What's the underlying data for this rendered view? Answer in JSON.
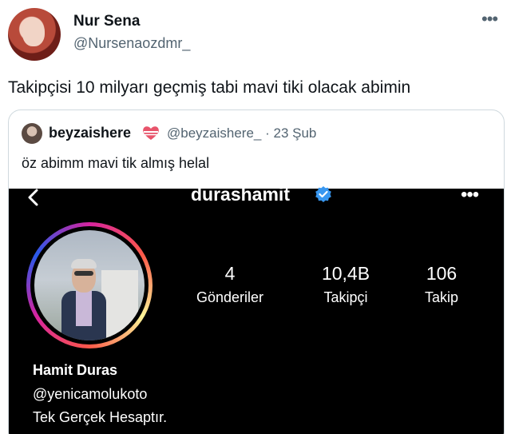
{
  "tweet": {
    "author_name": "Nur Sena",
    "author_handle": "@Nursenaozdmr_",
    "more_icon": "more-horizontal-icon",
    "text": "Takipçisi 10 milyarı geçmiş tabi mavi tiki olacak abimin"
  },
  "quote": {
    "author_name": "beyzaishere",
    "author_handle_date": "@beyzaishere_ · 23 Şub",
    "text": "öz abimm mavi tik almış helal",
    "name_emoji": "heart-with-ribbon-icon"
  },
  "instagram": {
    "username": "durashamit",
    "verified_icon": "verified-badge-icon",
    "stats": [
      {
        "value": "4",
        "label": "Gönderiler"
      },
      {
        "value": "10,4B",
        "label": "Takipçi"
      },
      {
        "value": "106",
        "label": "Takip"
      }
    ],
    "full_name": "Hamit Duras",
    "link": "@yenicamolukoto",
    "bio": "Tek Gerçek Hesaptır."
  },
  "colors": {
    "text_primary": "#0f1419",
    "text_secondary": "#536471",
    "border": "#cfd9de",
    "instagram_bg": "#000000",
    "verified_blue": "#3897f0"
  }
}
